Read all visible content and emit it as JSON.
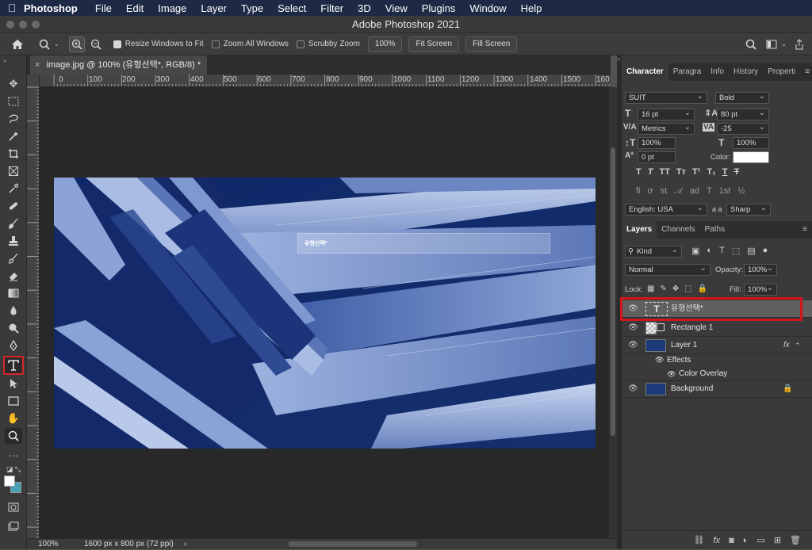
{
  "menubar": {
    "app_name": "Photoshop",
    "items": [
      "File",
      "Edit",
      "Image",
      "Layer",
      "Type",
      "Select",
      "Filter",
      "3D",
      "View",
      "Plugins",
      "Window",
      "Help"
    ]
  },
  "window": {
    "title": "Adobe Photoshop 2021"
  },
  "options": {
    "resize_windows": "Resize Windows to Fit",
    "zoom_all": "Zoom All Windows",
    "scrubby": "Scrubby Zoom",
    "zoom_value": "100%",
    "fit_screen": "Fit Screen",
    "fill_screen": "Fill Screen"
  },
  "doc_tab": {
    "title": "image.jpg @ 100% (유형선택*, RGB/8) *"
  },
  "ruler": {
    "h_ticks": [
      "0",
      "100",
      "200",
      "300",
      "400",
      "500",
      "600",
      "700",
      "800",
      "900",
      "1000",
      "1100",
      "1200",
      "1300",
      "1400",
      "1500",
      "160"
    ],
    "v_ticks": [
      "0",
      "1 0 0",
      "2 0 0",
      "3 0 0",
      "4 0 0",
      "5 0 0",
      "6 0 0",
      "7 0 0",
      "8 0 0"
    ]
  },
  "canvas": {
    "text_layer_text": "유형선택*"
  },
  "status": {
    "zoom": "100%",
    "doc_info": "1600 px x 800 px (72 ppi)"
  },
  "character": {
    "tabs": [
      "Character",
      "Paragra",
      "Info",
      "History",
      "Properti"
    ],
    "font_family": "SUIT",
    "font_style": "Bold",
    "font_size": "16 pt",
    "leading": "80 pt",
    "kerning": "Metrics",
    "tracking": "-25",
    "vscale": "100%",
    "hscale": "100%",
    "baseline": "0 pt",
    "color_label": "Color:",
    "color_value": "#ffffff",
    "language": "English: USA",
    "aa_label": "a a",
    "antialias": "Sharp"
  },
  "layers": {
    "tabs": [
      "Layers",
      "Channels",
      "Paths"
    ],
    "filter": "Kind",
    "blend": "Normal",
    "opacity_label": "Opacity:",
    "opacity": "100%",
    "lock_label": "Lock:",
    "fill_label": "Fill:",
    "fill": "100%",
    "rows": [
      {
        "name": "유형선택*"
      },
      {
        "name": "Rectangle 1"
      },
      {
        "name": "Layer 1"
      },
      {
        "name": "Effects"
      },
      {
        "name": "Color Overlay"
      },
      {
        "name": "Background"
      }
    ]
  }
}
